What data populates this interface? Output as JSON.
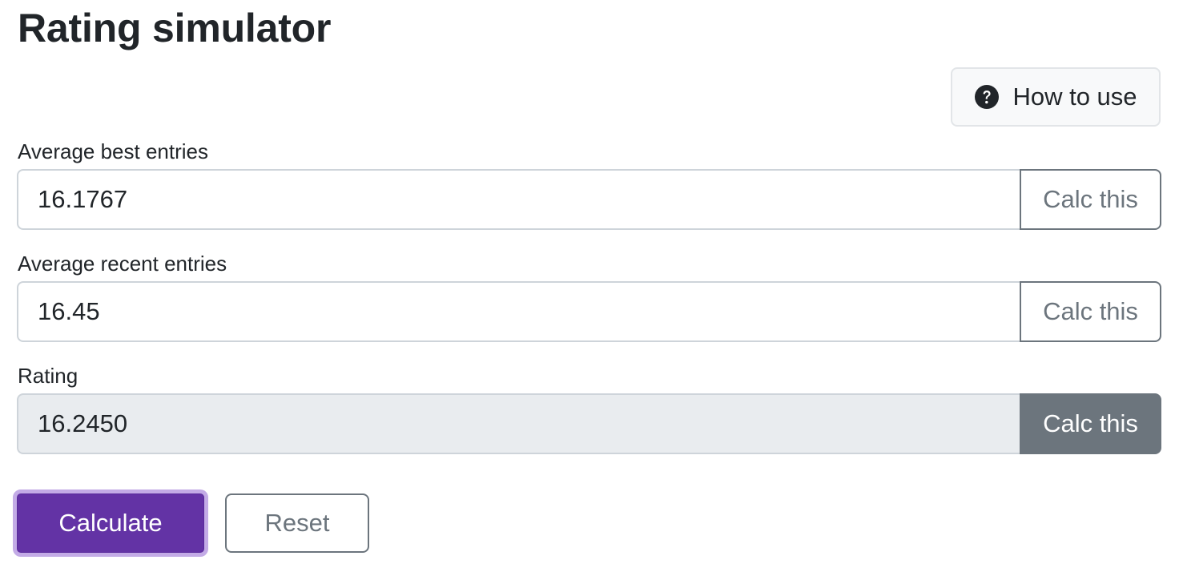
{
  "page": {
    "title": "Rating simulator"
  },
  "help": {
    "label": "How to use",
    "icon": "question-circle-icon"
  },
  "fields": [
    {
      "label": "Average best entries",
      "value": "16.1767",
      "button": "Calc this",
      "readonly": false
    },
    {
      "label": "Average recent entries",
      "value": "16.45",
      "button": "Calc this",
      "readonly": false
    },
    {
      "label": "Rating",
      "value": "16.2450",
      "button": "Calc this",
      "readonly": true
    }
  ],
  "actions": {
    "calculate_label": "Calculate",
    "reset_label": "Reset"
  },
  "colors": {
    "primary": "#6333a5",
    "secondary": "#6c757d",
    "readonly_bg": "#e9ecef"
  }
}
